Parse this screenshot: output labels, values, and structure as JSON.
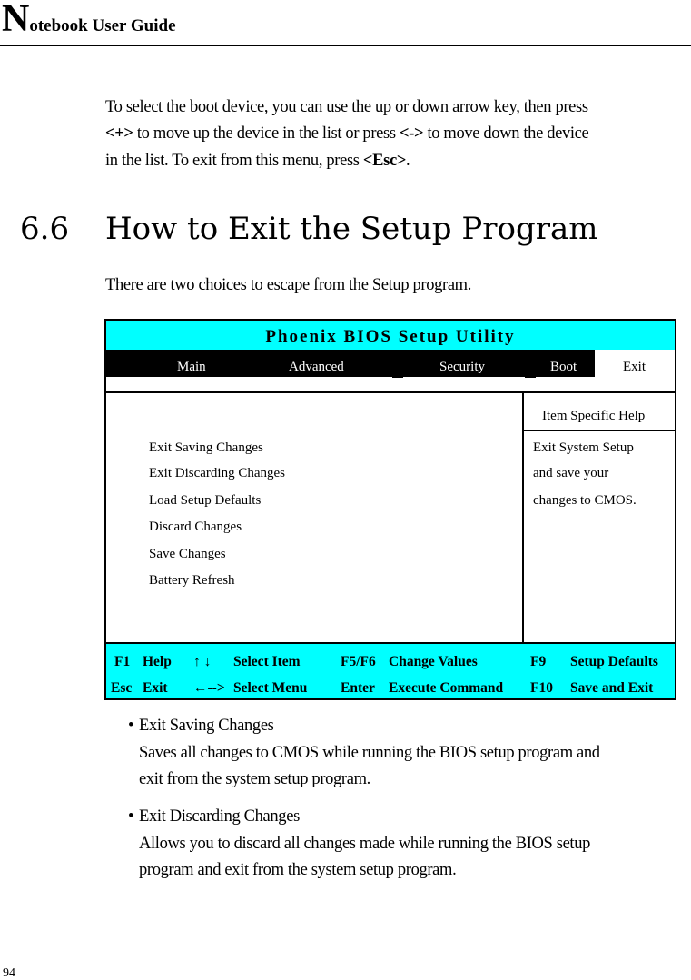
{
  "header": {
    "title_initial": "N",
    "title_rest": "otebook User Guide"
  },
  "intro": {
    "lines": [
      [
        "To select the boot device, you can use the up or down arrow key, then press"
      ],
      [
        "<+>",
        " to move up the device in the list or press ",
        "<->",
        " to move down the device"
      ],
      [
        "in the list. To exit from this menu, press ",
        "<Esc>",
        "."
      ]
    ]
  },
  "section": {
    "number": "6.6",
    "title": "How to Exit the Setup Program"
  },
  "lead": "There are two choices to escape from the Setup program.",
  "bios": {
    "title": "Phoenix BIOS Setup Utility",
    "tabs": [
      "Main",
      "Advanced",
      "Security",
      "Boot",
      "Exit"
    ],
    "active_tab": "Exit",
    "items": [
      "Exit Saving Changes",
      "Exit Discarding Changes",
      "Load Setup Defaults",
      "Discard Changes",
      "Save Changes",
      "Battery Refresh"
    ],
    "help_title": "Item Specific Help",
    "help_lines": [
      "Exit System Setup",
      "and save your",
      "changes to CMOS."
    ],
    "keys": [
      [
        "F1",
        "Help",
        "↑ ↓",
        "Select Item",
        "F5/F6",
        "Change Values",
        "F9",
        "Setup Defaults"
      ],
      [
        "Esc",
        "Exit",
        "←-->",
        "Select Menu",
        "Enter",
        "Execute Command",
        "F10",
        "Save and Exit"
      ]
    ],
    "colors": {
      "title_bg": "#00ffff",
      "tab_bar_bg": "#000000"
    }
  },
  "bullets": [
    {
      "title": "Exit Saving Changes",
      "lines": [
        "Saves all changes to CMOS while running the BIOS setup program and",
        "exit from the system setup program."
      ]
    },
    {
      "title": "Exit Discarding Changes",
      "lines": [
        "Allows you to discard all changes made while running the BIOS setup",
        "program and exit from the system setup program."
      ]
    }
  ],
  "footer": {
    "page_number": "94"
  }
}
